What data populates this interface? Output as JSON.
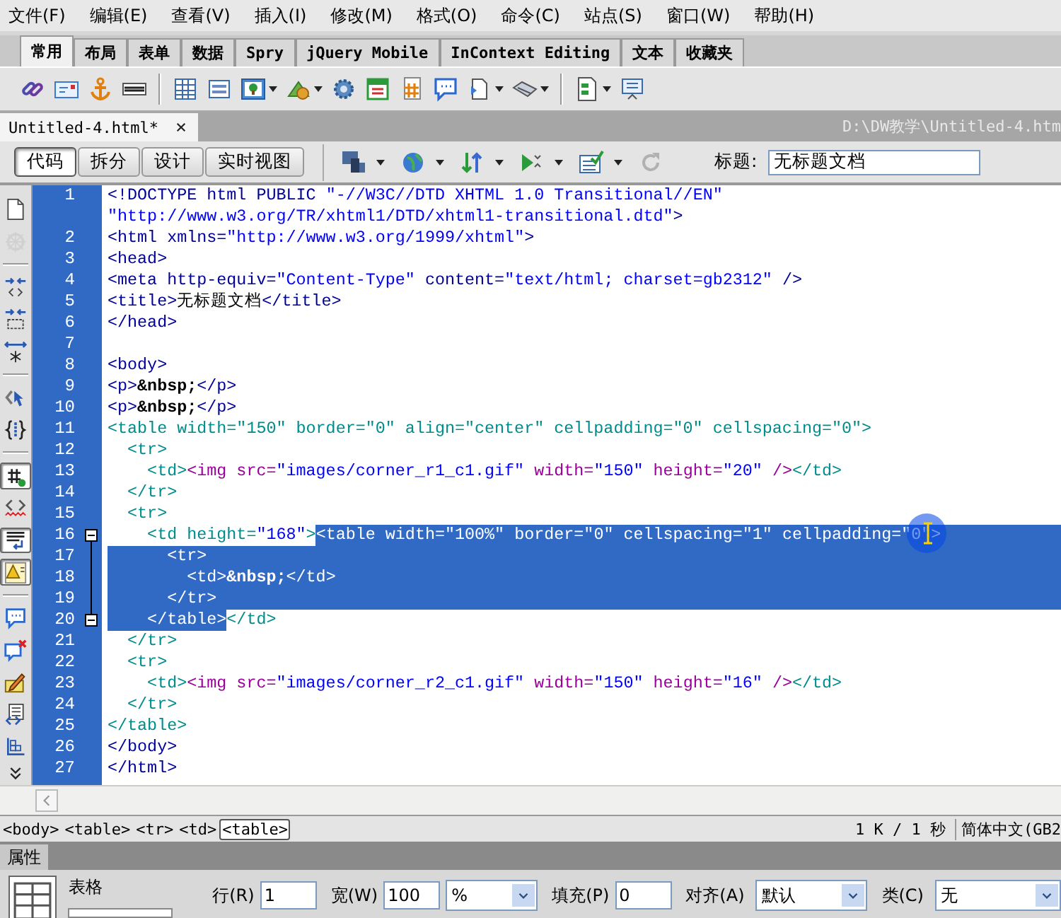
{
  "menu": [
    "文件(F)",
    "编辑(E)",
    "查看(V)",
    "插入(I)",
    "修改(M)",
    "格式(O)",
    "命令(C)",
    "站点(S)",
    "窗口(W)",
    "帮助(H)"
  ],
  "insert_tabs": [
    {
      "label": "常用",
      "selected": true
    },
    {
      "label": "布局",
      "selected": false
    },
    {
      "label": "表单",
      "selected": false
    },
    {
      "label": "数据",
      "selected": false
    },
    {
      "label": "Spry",
      "selected": false
    },
    {
      "label": "jQuery Mobile",
      "selected": false
    },
    {
      "label": "InContext Editing",
      "selected": false
    },
    {
      "label": "文本",
      "selected": false
    },
    {
      "label": "收藏夹",
      "selected": false
    }
  ],
  "document_tab": {
    "label": "Untitled-4.html*",
    "path": "D:\\DW教学\\Untitled-4.htm"
  },
  "view_buttons": [
    {
      "label": "代码",
      "selected": true
    },
    {
      "label": "拆分",
      "selected": false
    },
    {
      "label": "设计",
      "selected": false
    },
    {
      "label": "实时视图",
      "selected": false
    }
  ],
  "title_field": {
    "label": "标题:",
    "value": "无标题文档"
  },
  "coding_toolbar": [
    {
      "pressed": false,
      "disabled": false
    },
    {
      "pressed": false,
      "disabled": true
    },
    {
      "pressed": false,
      "disabled": false
    },
    {
      "pressed": false,
      "disabled": false
    },
    {
      "pressed": false,
      "disabled": false
    },
    {
      "pressed": false,
      "disabled": false
    },
    {
      "pressed": false,
      "disabled": false
    },
    {
      "pressed": true,
      "disabled": false
    },
    {
      "pressed": false,
      "disabled": false
    },
    {
      "pressed": true,
      "disabled": false
    },
    {
      "pressed": true,
      "disabled": false
    },
    {
      "pressed": false,
      "disabled": false
    },
    {
      "pressed": false,
      "disabled": false
    },
    {
      "pressed": false,
      "disabled": false
    },
    {
      "pressed": false,
      "disabled": false
    },
    {
      "pressed": false,
      "disabled": false
    }
  ],
  "code_rows": [
    {
      "number": "1",
      "segments": [
        {
          "kind": "tag",
          "text": "<!DOCTYPE html PUBLIC ",
          "selected": false
        },
        {
          "kind": "value",
          "text": "\"-//W3C//DTD XHTML 1.0 Transitional//EN\"",
          "selected": false
        }
      ]
    },
    {
      "segments": [
        {
          "kind": "value",
          "text": "\"http://www.w3.org/TR/xhtml1/DTD/xhtml1-transitional.dtd\"",
          "selected": false
        },
        {
          "kind": "tag",
          "text": ">",
          "selected": false
        }
      ]
    },
    {
      "number": "2",
      "segments": [
        {
          "kind": "tag",
          "text": "<html xmlns=",
          "selected": false
        },
        {
          "kind": "value",
          "text": "\"http://www.w3.org/1999/xhtml\"",
          "selected": false
        },
        {
          "kind": "tag",
          "text": ">",
          "selected": false
        }
      ]
    },
    {
      "number": "3",
      "segments": [
        {
          "kind": "tag",
          "text": "<head>",
          "selected": false
        }
      ]
    },
    {
      "number": "4",
      "segments": [
        {
          "kind": "tag",
          "text": "<meta http-equiv=",
          "selected": false
        },
        {
          "kind": "value",
          "text": "\"Content-Type\"",
          "selected": false
        },
        {
          "kind": "tag",
          "text": " content=",
          "selected": false
        },
        {
          "kind": "value",
          "text": "\"text/html; charset=gb2312\"",
          "selected": false
        },
        {
          "kind": "tag",
          "text": " />",
          "selected": false
        }
      ]
    },
    {
      "number": "5",
      "segments": [
        {
          "kind": "tag",
          "text": "<title>",
          "selected": false
        },
        {
          "kind": "text",
          "text": "无标题文档",
          "selected": false
        },
        {
          "kind": "tag",
          "text": "</title>",
          "selected": false
        }
      ]
    },
    {
      "number": "6",
      "segments": [
        {
          "kind": "tag",
          "text": "</head>",
          "selected": false
        }
      ]
    },
    {
      "number": "7",
      "segments": []
    },
    {
      "number": "8",
      "segments": [
        {
          "kind": "tag",
          "text": "<body>",
          "selected": false
        }
      ]
    },
    {
      "number": "9",
      "segments": [
        {
          "kind": "tag",
          "text": "<p>",
          "selected": false
        },
        {
          "kind": "entity",
          "text": "&nbsp;",
          "selected": false
        },
        {
          "kind": "tag",
          "text": "</p>",
          "selected": false
        }
      ]
    },
    {
      "number": "10",
      "segments": [
        {
          "kind": "tag",
          "text": "<p>",
          "selected": false
        },
        {
          "kind": "entity",
          "text": "&nbsp;",
          "selected": false
        },
        {
          "kind": "tag",
          "text": "</p>",
          "selected": false
        }
      ]
    },
    {
      "number": "11",
      "segments": [
        {
          "kind": "table",
          "text": "<table width=\"150\" border=\"0\" align=\"center\" cellpadding=\"0\" cellspacing=\"0\">",
          "selected": false
        }
      ]
    },
    {
      "number": "12",
      "segments": [
        {
          "kind": "table",
          "text": "  <tr>",
          "selected": false
        }
      ]
    },
    {
      "number": "13",
      "segments": [
        {
          "kind": "table",
          "text": "    <td>",
          "selected": false
        },
        {
          "kind": "image",
          "text": "<img src=",
          "selected": false
        },
        {
          "kind": "value",
          "text": "\"images/corner_r1_c1.gif\"",
          "selected": false
        },
        {
          "kind": "image",
          "text": " width=",
          "selected": false
        },
        {
          "kind": "value",
          "text": "\"150\"",
          "selected": false
        },
        {
          "kind": "image",
          "text": " height=",
          "selected": false
        },
        {
          "kind": "value",
          "text": "\"20\"",
          "selected": false
        },
        {
          "kind": "image",
          "text": " />",
          "selected": false
        },
        {
          "kind": "table",
          "text": "</td>",
          "selected": false
        }
      ]
    },
    {
      "number": "14",
      "segments": [
        {
          "kind": "table",
          "text": "  </tr>",
          "selected": false
        }
      ]
    },
    {
      "number": "15",
      "segments": [
        {
          "kind": "table",
          "text": "  <tr>",
          "selected": false
        }
      ]
    },
    {
      "number": "16",
      "fold_start": true,
      "eol_selected": true,
      "segments": [
        {
          "kind": "table",
          "text": "    <td height=",
          "selected": false
        },
        {
          "kind": "value",
          "text": "\"168\"",
          "selected": false
        },
        {
          "kind": "table",
          "text": ">",
          "selected": false
        },
        {
          "kind": "table",
          "text": "<table width=\"100%\" border=\"0\" cellspacing=\"1\" cellpadding=\"0\">",
          "selected": true
        }
      ]
    },
    {
      "number": "17",
      "eol_selected": true,
      "segments": [
        {
          "kind": "table",
          "text": "      <tr>",
          "selected": true
        }
      ]
    },
    {
      "number": "18",
      "eol_selected": true,
      "segments": [
        {
          "kind": "table",
          "text": "        <td>",
          "selected": true
        },
        {
          "kind": "entity",
          "text": "&nbsp;",
          "selected": true
        },
        {
          "kind": "table",
          "text": "</td>",
          "selected": true
        }
      ]
    },
    {
      "number": "19",
      "eol_selected": true,
      "segments": [
        {
          "kind": "table",
          "text": "      </tr>",
          "selected": true
        }
      ]
    },
    {
      "number": "20",
      "fold_end": true,
      "segments": [
        {
          "kind": "table",
          "text": "    </table>",
          "selected": true
        },
        {
          "kind": "table",
          "text": "</td>",
          "selected": false
        }
      ]
    },
    {
      "number": "21",
      "segments": [
        {
          "kind": "table",
          "text": "  </tr>",
          "selected": false
        }
      ]
    },
    {
      "number": "22",
      "segments": [
        {
          "kind": "table",
          "text": "  <tr>",
          "selected": false
        }
      ]
    },
    {
      "number": "23",
      "segments": [
        {
          "kind": "table",
          "text": "    <td>",
          "selected": false
        },
        {
          "kind": "image",
          "text": "<img src=",
          "selected": false
        },
        {
          "kind": "value",
          "text": "\"images/corner_r2_c1.gif\"",
          "selected": false
        },
        {
          "kind": "image",
          "text": " width=",
          "selected": false
        },
        {
          "kind": "value",
          "text": "\"150\"",
          "selected": false
        },
        {
          "kind": "image",
          "text": " height=",
          "selected": false
        },
        {
          "kind": "value",
          "text": "\"16\"",
          "selected": false
        },
        {
          "kind": "image",
          "text": " />",
          "selected": false
        },
        {
          "kind": "table",
          "text": "</td>",
          "selected": false
        }
      ]
    },
    {
      "number": "24",
      "segments": [
        {
          "kind": "table",
          "text": "  </tr>",
          "selected": false
        }
      ]
    },
    {
      "number": "25",
      "segments": [
        {
          "kind": "table",
          "text": "</table>",
          "selected": false
        }
      ]
    },
    {
      "number": "26",
      "segments": [
        {
          "kind": "tag",
          "text": "</body>",
          "selected": false
        }
      ]
    },
    {
      "number": "27",
      "segments": [
        {
          "kind": "tag",
          "text": "</html>",
          "selected": false
        }
      ]
    }
  ],
  "tag_selector": [
    {
      "label": "<body>",
      "selected": false
    },
    {
      "label": "<table>",
      "selected": false
    },
    {
      "label": "<tr>",
      "selected": false
    },
    {
      "label": "<td>",
      "selected": false
    },
    {
      "label": "<table>",
      "selected": true
    }
  ],
  "status": {
    "download": "1 K / 1 秒",
    "encoding": "简体中文(GB2"
  },
  "properties": {
    "tab": "属性",
    "element": "表格",
    "fields": [
      {
        "kind": "input",
        "label": "行(R)",
        "value": "1"
      },
      {
        "kind": "input",
        "label": "宽(W)",
        "value": "100"
      },
      {
        "kind": "select",
        "value": "%"
      },
      {
        "kind": "input",
        "label": "填充(P)",
        "value": "0"
      },
      {
        "kind": "select",
        "label": "对齐(A)",
        "value": "默认"
      },
      {
        "kind": "select",
        "label": "类(C)",
        "value": "无"
      }
    ]
  }
}
